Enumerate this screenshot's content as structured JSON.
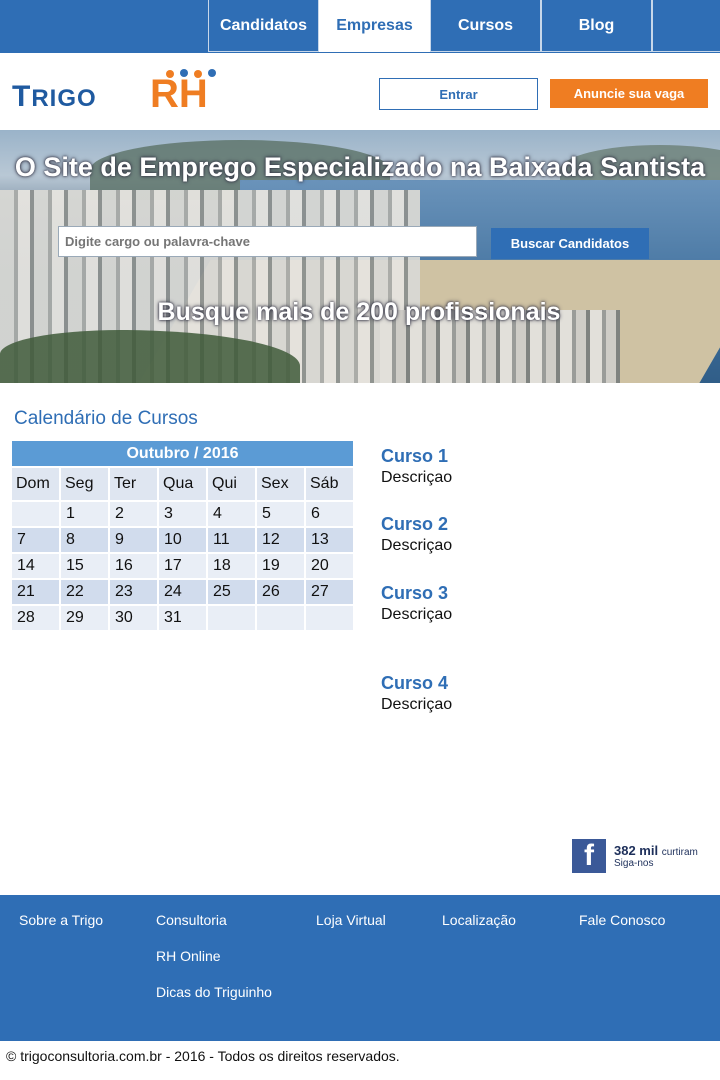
{
  "nav": {
    "tabs": [
      {
        "label": "Candidatos",
        "active": false
      },
      {
        "label": "Empresas",
        "active": true
      },
      {
        "label": "Cursos",
        "active": false
      },
      {
        "label": "Blog",
        "active": false
      }
    ]
  },
  "header": {
    "logo_text_1": "TrigoRH",
    "entrar_label": "Entrar",
    "anuncie_label": "Anuncie sua vaga"
  },
  "hero": {
    "title": "O Site de Emprego Especializado na Baixada Santista",
    "search_placeholder": "Digite cargo ou palavra-chave",
    "search_button": "Buscar Candidatos",
    "subtitle": "Busque mais de 200 profissionais"
  },
  "calendar": {
    "section_title": "Calendário de Cursos",
    "month": "Outubro / 2016",
    "weekdays": [
      "Dom",
      "Seg",
      "Ter",
      "Qua",
      "Qui",
      "Sex",
      "Sáb"
    ],
    "weeks": [
      [
        "",
        "1",
        "2",
        "3",
        "4",
        "5",
        "6"
      ],
      [
        "7",
        "8",
        "9",
        "10",
        "11",
        "12",
        "13"
      ],
      [
        "14",
        "15",
        "16",
        "17",
        "18",
        "19",
        "20"
      ],
      [
        "21",
        "22",
        "23",
        "24",
        "25",
        "26",
        "27"
      ],
      [
        "28",
        "29",
        "30",
        "31",
        "",
        "",
        ""
      ]
    ]
  },
  "courses": [
    {
      "title": "Curso 1",
      "desc": "Descriçao"
    },
    {
      "title": "Curso 2",
      "desc": "Descriçao"
    },
    {
      "title": "Curso 3",
      "desc": "Descriçao"
    },
    {
      "title": "Curso 4",
      "desc": "Descriçao"
    }
  ],
  "facebook": {
    "count": "382 mil",
    "count_suffix": "curtiram",
    "follow": "Siga-nos",
    "icon": "facebook-icon"
  },
  "footer": {
    "links": [
      "Sobre a Trigo",
      "Consultoria",
      "RH Online",
      "Dicas do Triguinho",
      "Loja Virtual",
      "Localização",
      "Fale Conosco"
    ],
    "copyright": "© trigoconsultoria.com.br - 2016 - Todos os direitos reservados."
  },
  "colors": {
    "primary": "#2f6eb5",
    "accent": "#ef7d22"
  }
}
